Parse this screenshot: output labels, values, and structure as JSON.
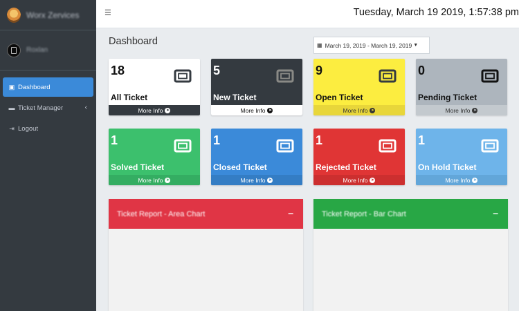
{
  "sidebar": {
    "brand": "Worx Zervices",
    "user_name": "Roxlan",
    "items": [
      {
        "label": "Dashboard",
        "icon": "dashboard-icon",
        "active": true
      },
      {
        "label": "Ticket Manager",
        "icon": "ticket-icon",
        "active": false
      },
      {
        "label": "Logout",
        "icon": "logout-icon",
        "active": false
      }
    ]
  },
  "topbar": {
    "datetime": "Tuesday, March 19 2019, 1:57:38 pm"
  },
  "content": {
    "page_title": "Dashboard",
    "date_range": "March 19, 2019 - March 19, 2019",
    "cards": [
      {
        "value": "18",
        "label": "All Ticket",
        "footer": "More Info",
        "bg": "#ffffff",
        "fg": "#111111",
        "footer_bg": "#343a40",
        "footer_fg": "#ffffff",
        "icon_color": "#343a40"
      },
      {
        "value": "5",
        "label": "New Ticket",
        "footer": "More Info",
        "bg": "#343a40",
        "fg": "#ffffff",
        "footer_bg": "#ffffff",
        "footer_fg": "#111111",
        "icon_color": "#8a8a86"
      },
      {
        "value": "9",
        "label": "Open Ticket",
        "footer": "More Info",
        "bg": "#fced40",
        "fg": "#111111",
        "footer_bg": "#e8d63a",
        "footer_fg": "#333333",
        "icon_color": "#343a40"
      },
      {
        "value": "0",
        "label": "Pending Ticket",
        "footer": "More Info",
        "bg": "#adb5bd",
        "fg": "#111111",
        "footer_bg": "#c3c9ce",
        "footer_fg": "#333333",
        "icon_color": "#111111"
      },
      {
        "value": "1",
        "label": "Solved Ticket",
        "footer": "More Info",
        "bg": "#3cc06d",
        "fg": "#ffffff",
        "footer_bg": "#34ad62",
        "footer_fg": "#ffffff",
        "icon_color": "#ffffff"
      },
      {
        "value": "1",
        "label": "Closed Ticket",
        "footer": "More Info",
        "bg": "#3b8ad9",
        "fg": "#ffffff",
        "footer_bg": "#347dc4",
        "footer_fg": "#ffffff",
        "icon_color": "#ffffff"
      },
      {
        "value": "1",
        "label": "Rejected Ticket",
        "footer": "More Info",
        "bg": "#e03535",
        "fg": "#ffffff",
        "footer_bg": "#cc2f2f",
        "footer_fg": "#ffffff",
        "icon_color": "#ffffff"
      },
      {
        "value": "1",
        "label": "On Hold Ticket",
        "footer": "More Info",
        "bg": "#6eb4ea",
        "fg": "#ffffff",
        "footer_bg": "#62a6d9",
        "footer_fg": "#ffffff",
        "icon_color": "#ffffff"
      }
    ],
    "panels": [
      {
        "title": "Ticket Report - Area Chart",
        "color": "#e03545",
        "minimize": "–"
      },
      {
        "title": "Ticket Report - Bar Chart",
        "color": "#28a745",
        "minimize": "–"
      }
    ]
  }
}
